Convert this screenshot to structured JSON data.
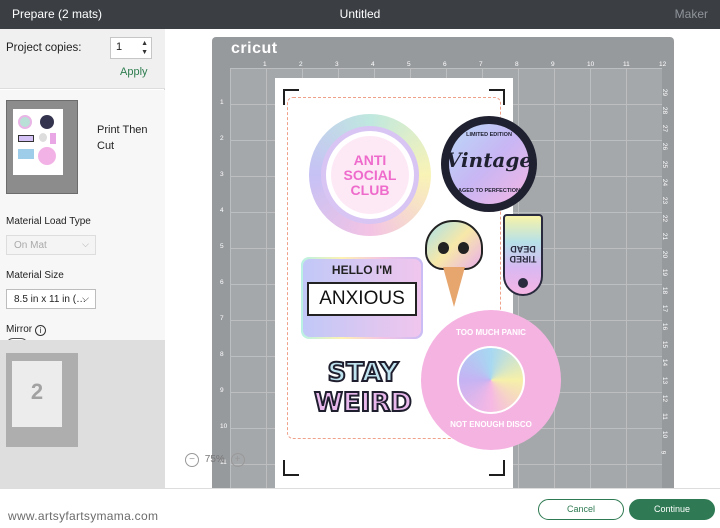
{
  "header": {
    "title_left": "Prepare (2 mats)",
    "title_center": "Untitled",
    "machine": "Maker"
  },
  "left": {
    "copies_label": "Project copies:",
    "copies_value": "1",
    "apply": "Apply",
    "mat1": {
      "label": "Print Then Cut"
    },
    "material_load_type": {
      "label": "Material Load Type",
      "value": "On Mat"
    },
    "material_size": {
      "label": "Material Size",
      "value": "8.5 in x 11 in (…"
    },
    "mirror": {
      "label": "Mirror",
      "on": false
    },
    "mat2": {
      "number": "2"
    }
  },
  "canvas": {
    "brand": "cricut",
    "ruler_top": [
      "1",
      "2",
      "3",
      "4",
      "5",
      "6",
      "7",
      "8",
      "9",
      "10",
      "11",
      "12"
    ],
    "ruler_left": [
      "1",
      "2",
      "3",
      "4",
      "5",
      "6",
      "7",
      "8",
      "9",
      "10",
      "11"
    ],
    "ruler_right": [
      "29",
      "28",
      "27",
      "26",
      "25",
      "24",
      "23",
      "22",
      "21",
      "20",
      "19",
      "18",
      "17",
      "16",
      "15",
      "14",
      "13",
      "12",
      "11",
      "10",
      "9"
    ],
    "zoom": "75%"
  },
  "stickers": {
    "anti": [
      "ANTI",
      "SOCIAL",
      "CLUB"
    ],
    "vintage": {
      "top": "LIMITED EDITION",
      "main": "Vintage",
      "bottom": "AGED TO PERFECTION"
    },
    "tired": [
      "TIRED",
      "DEAD"
    ],
    "hello": {
      "top": "HELLO I'M",
      "main": "ANXIOUS"
    },
    "weird": [
      "STAY",
      "WEIRD"
    ],
    "disco": {
      "top": "TOO MUCH PANIC",
      "bottom": "NOT ENOUGH DISCO"
    }
  },
  "footer": {
    "watermark": "www.artsyfartsymama.com",
    "cancel": "Cancel",
    "continue": "Continue"
  },
  "colors": {
    "accent": "#2f7a54",
    "header": "#3b3f44"
  }
}
